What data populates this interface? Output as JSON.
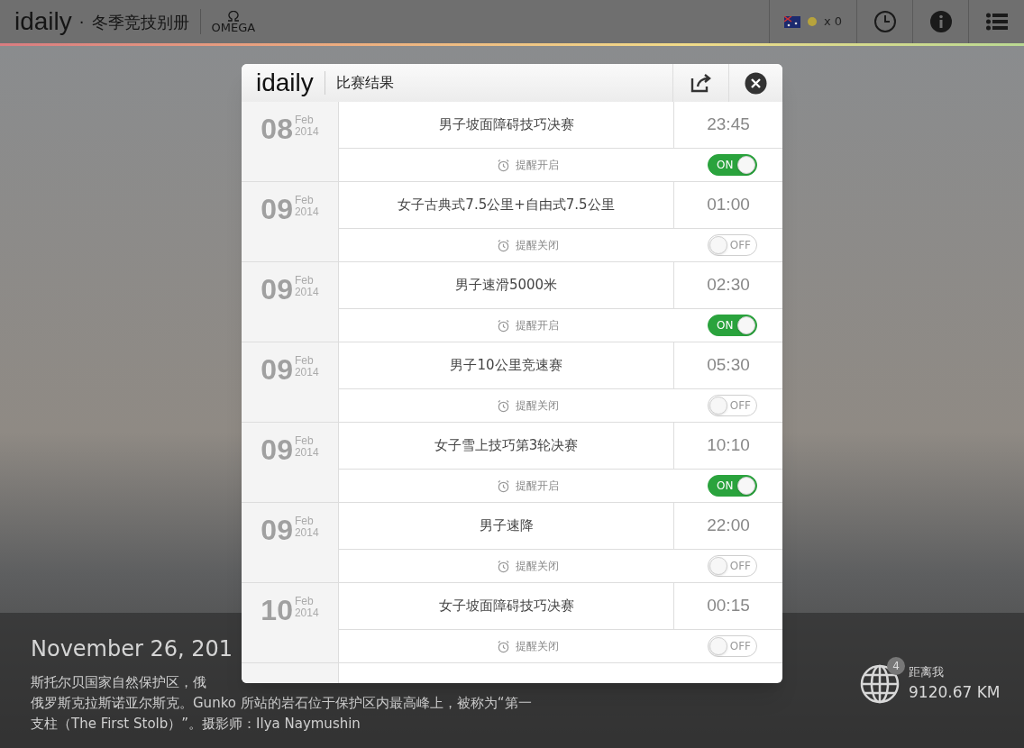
{
  "top_bar": {
    "logo": "idaily",
    "separator": "·",
    "title": "冬季竞技别册",
    "sponsor": "OMEGA",
    "medal_count": "x 0"
  },
  "caption": {
    "date": "November 26, 201",
    "lines": [
      "斯托尔贝国家自然保护区，俄",
      "俄罗斯克拉斯诺亚尔斯克。Gunko 所站的岩石位于保护区内最高峰上，被称为“第一",
      "支柱（The First Stolb）”。摄影师：Ilya Naymushin"
    ]
  },
  "distance": {
    "badge": "4",
    "label": "距离我",
    "value": "9120.67 KM"
  },
  "modal": {
    "logo": "idaily",
    "title": "比赛结果",
    "events": [
      {
        "day": "08",
        "month": "Feb",
        "year": "2014",
        "name": "男子坡面障碍技巧决赛",
        "time": "23:45",
        "reminder": "提醒开启",
        "toggle_label": "ON",
        "on": true
      },
      {
        "day": "09",
        "month": "Feb",
        "year": "2014",
        "name": "女子古典式7.5公里+自由式7.5公里",
        "time": "01:00",
        "reminder": "提醒关闭",
        "toggle_label": "OFF",
        "on": false
      },
      {
        "day": "09",
        "month": "Feb",
        "year": "2014",
        "name": "男子速滑5000米",
        "time": "02:30",
        "reminder": "提醒开启",
        "toggle_label": "ON",
        "on": true
      },
      {
        "day": "09",
        "month": "Feb",
        "year": "2014",
        "name": "男子10公里竞速赛",
        "time": "05:30",
        "reminder": "提醒关闭",
        "toggle_label": "OFF",
        "on": false
      },
      {
        "day": "09",
        "month": "Feb",
        "year": "2014",
        "name": "女子雪上技巧第3轮决赛",
        "time": "10:10",
        "reminder": "提醒开启",
        "toggle_label": "ON",
        "on": true
      },
      {
        "day": "09",
        "month": "Feb",
        "year": "2014",
        "name": "男子速降",
        "time": "22:00",
        "reminder": "提醒关闭",
        "toggle_label": "OFF",
        "on": false
      },
      {
        "day": "10",
        "month": "Feb",
        "year": "2014",
        "name": "女子坡面障碍技巧决赛",
        "time": "00:15",
        "reminder": "提醒关闭",
        "toggle_label": "OFF",
        "on": false
      }
    ]
  }
}
